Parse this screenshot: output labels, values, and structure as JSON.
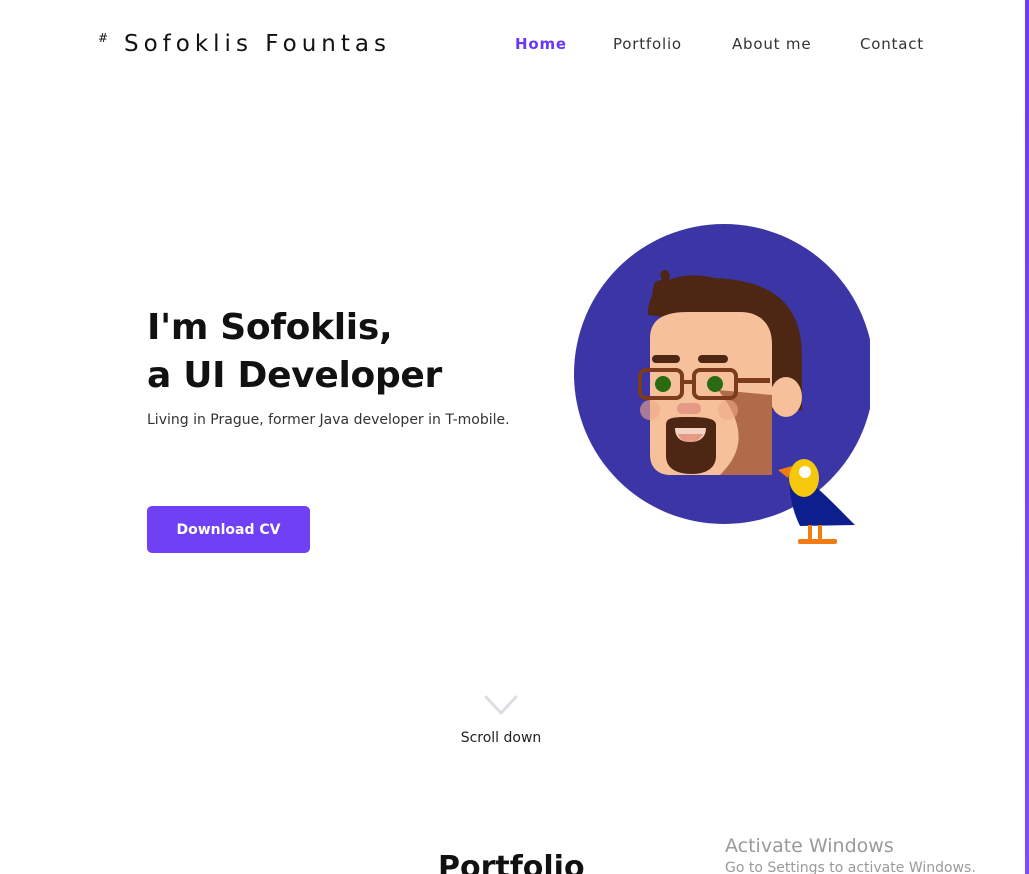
{
  "header": {
    "logo_mark": "#",
    "logo_text": "Sofoklis Fountas",
    "nav": [
      {
        "label": "Home",
        "active": true
      },
      {
        "label": "Portfolio",
        "active": false
      },
      {
        "label": "About me",
        "active": false
      },
      {
        "label": "Contact",
        "active": false
      }
    ]
  },
  "hero": {
    "headline_line1": "I'm Sofoklis,",
    "headline_line2": "a UI Developer",
    "subtitle": "Living in Prague, former Java developer in T-mobile.",
    "cta_label": "Download CV",
    "illustration": "avatar-with-parrot"
  },
  "scroll": {
    "label": "Scroll down",
    "icon": "chevron-down-icon"
  },
  "portfolio_section": {
    "title": "Portfolio"
  },
  "os_overlay": {
    "title": "Activate Windows",
    "message": "Go to Settings to activate Windows."
  },
  "colors": {
    "accent": "#7040f5",
    "avatar_circle": "#3c35a6",
    "text": "#111111"
  }
}
